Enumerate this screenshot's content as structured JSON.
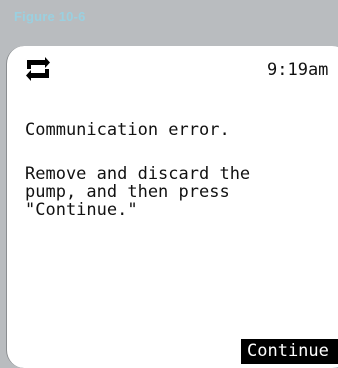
{
  "figure_label": "Figure 10-6",
  "status_bar": {
    "icon": "sync-arrows-icon",
    "time": "9:19am"
  },
  "alert": {
    "title": "Communication error.",
    "message": "Remove and discard the\npump, and then press\n\"Continue.\""
  },
  "buttons": {
    "continue_label": "Continue"
  },
  "colors": {
    "background": "#b9bcbf",
    "figure_label": "#9ad0e0",
    "screen": "#ffffff",
    "button_bg": "#000000",
    "button_text": "#ffffff"
  }
}
